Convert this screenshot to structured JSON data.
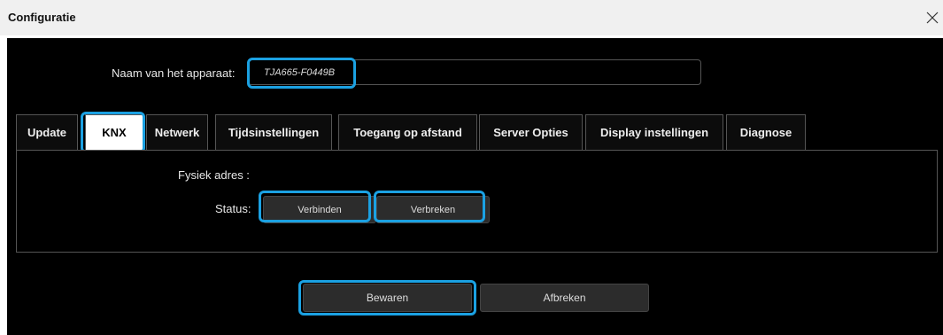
{
  "window": {
    "title": "Configuratie",
    "close_icon": "close-icon"
  },
  "device_name": {
    "label": "Naam van het apparaat:",
    "value": "TJA665-F0449B"
  },
  "tabs": [
    {
      "label": "Update"
    },
    {
      "label": "KNX",
      "active": true
    },
    {
      "label": "Netwerk"
    },
    {
      "label": "Tijdsinstellingen"
    },
    {
      "label": "Toegang op afstand"
    },
    {
      "label": "Server Opties"
    },
    {
      "label": "Display instellingen"
    },
    {
      "label": "Diagnose"
    }
  ],
  "knx": {
    "physical_address_label": "Fysiek adres :",
    "status_label": "Status:",
    "connect_label": "Verbinden",
    "disconnect_label": "Verbreken"
  },
  "footer": {
    "save_label": "Bewaren",
    "cancel_label": "Afbreken"
  },
  "colors": {
    "highlight": "#1ba1e2",
    "background": "#000000",
    "titlebar": "#f0f0f0"
  }
}
